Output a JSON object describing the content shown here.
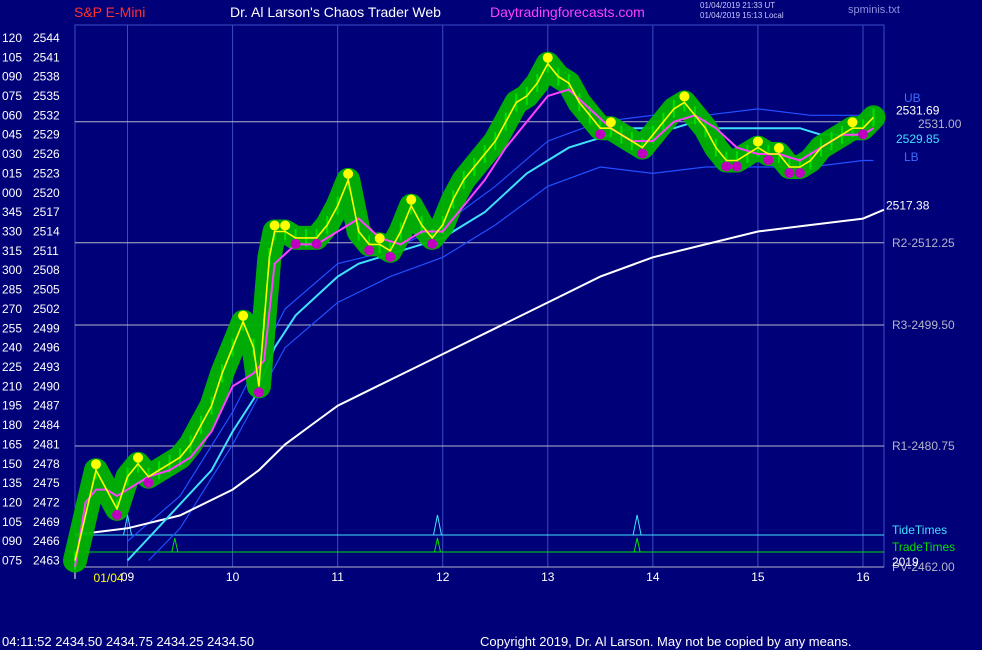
{
  "header": {
    "symbol": "S&P E-Mini",
    "site_title": "Dr. Al Larson's Chaos Trader Web",
    "site_url": "Daytradingforecasts.com",
    "time_utc": "01/04/2019 21:33 UT",
    "time_local": "01/04/2019 15:13 Local",
    "file_name": "spminis.txt"
  },
  "footer": {
    "quote": "04:11:52  2434.50  2434.75  2434.25  2434.50",
    "copyright": "Copyright 2019, Dr. Al Larson. May not be copied by any means."
  },
  "colors": {
    "background": "#000078",
    "price_line": "#ffff00",
    "price_bar": "#00e000",
    "glow": "#00b400",
    "high_dot": "#ffff00",
    "low_dot": "#c000c0",
    "ma_fast": "#ff40ff",
    "ma_cyan": "#40e0ff",
    "ma_white": "#ffffff",
    "band": "#2050ff",
    "grid": "#3c4cc8",
    "level": "#b4b4c8",
    "tide": "#40e0ff",
    "trade": "#00e000",
    "header_symbol": "#ff3030",
    "header_title": "#ffffff",
    "header_url": "#ff40ff",
    "footer_text": "#ffffff",
    "axis_text": "#ffffff",
    "date_text": "#ffff00"
  },
  "chart_data": {
    "type": "line",
    "title": "S&P E-Mini",
    "y_axis": {
      "range": [
        2462,
        2546
      ],
      "left_labels": [
        "120",
        "105",
        "090",
        "075",
        "060",
        "045",
        "030",
        "015",
        "000",
        "345",
        "330",
        "315",
        "300",
        "285",
        "270",
        "255",
        "240",
        "225",
        "210",
        "195",
        "180",
        "165",
        "150",
        "135",
        "120",
        "105",
        "090",
        "075"
      ],
      "right_labels": [
        "2544",
        "2541",
        "2538",
        "2535",
        "2532",
        "2529",
        "2526",
        "2523",
        "2520",
        "2517",
        "2514",
        "2511",
        "2508",
        "2505",
        "2502",
        "2499",
        "2496",
        "2493",
        "2490",
        "2487",
        "2484",
        "2481",
        "2478",
        "2475",
        "2472",
        "2469",
        "2466",
        "2463"
      ]
    },
    "x_axis": {
      "range": [
        8.5,
        16.2
      ],
      "ticks": [
        9,
        10,
        11,
        12,
        13,
        14,
        15,
        16
      ],
      "tick_labels": [
        "09",
        "10",
        "11",
        "12",
        "13",
        "14",
        "15",
        "16"
      ],
      "date_label": "01/04"
    },
    "levels": [
      {
        "label": "R2-2512.25",
        "value": 2512.25
      },
      {
        "label": "R3-2499.50",
        "value": 2499.5
      },
      {
        "label": "R1-2480.75",
        "value": 2480.75
      },
      {
        "label": "PV-2462.00",
        "value": 2462.0
      }
    ],
    "markers": [
      {
        "label": "2531.69",
        "value": 2531.69,
        "color": "#ffffff"
      },
      {
        "label": "2531.00",
        "value": 2531.0,
        "color": "#b4b4c8"
      },
      {
        "label": "2529.85",
        "value": 2529.85,
        "color": "#40e0ff"
      },
      {
        "label": "2517.38",
        "value": 2517.38,
        "color": "#ffffff"
      }
    ],
    "band_labels": {
      "upper": "UB",
      "lower": "LB"
    },
    "series": [
      {
        "name": "price",
        "x": [
          8.5,
          8.7,
          8.9,
          9.0,
          9.1,
          9.2,
          9.3,
          9.4,
          9.5,
          9.6,
          9.7,
          9.8,
          9.9,
          10.0,
          10.1,
          10.2,
          10.25,
          10.3,
          10.35,
          10.4,
          10.5,
          10.6,
          10.7,
          10.8,
          10.9,
          11.0,
          11.1,
          11.2,
          11.3,
          11.4,
          11.5,
          11.6,
          11.7,
          11.8,
          11.9,
          12.0,
          12.1,
          12.2,
          12.3,
          12.4,
          12.5,
          12.6,
          12.7,
          12.8,
          12.9,
          13.0,
          13.1,
          13.2,
          13.3,
          13.4,
          13.5,
          13.6,
          13.7,
          13.8,
          13.9,
          14.0,
          14.1,
          14.2,
          14.3,
          14.4,
          14.5,
          14.6,
          14.7,
          14.8,
          14.9,
          15.0,
          15.1,
          15.2,
          15.3,
          15.4,
          15.5,
          15.6,
          15.7,
          15.8,
          15.9,
          16.0,
          16.1
        ],
        "values": [
          2463,
          2477,
          2471,
          2476,
          2478,
          2476,
          2477,
          2478,
          2479,
          2481,
          2484,
          2487,
          2492,
          2496,
          2500,
          2496,
          2490,
          2500,
          2510,
          2514,
          2514,
          2513,
          2513,
          2513,
          2515,
          2518,
          2522,
          2514,
          2512,
          2512,
          2511,
          2514,
          2518,
          2515,
          2513,
          2515,
          2519,
          2522,
          2524,
          2526,
          2528,
          2531,
          2534,
          2535,
          2537,
          2540,
          2538,
          2537,
          2534,
          2532,
          2530,
          2530,
          2529,
          2528,
          2527,
          2529,
          2531,
          2533,
          2534,
          2532,
          2530,
          2527,
          2525,
          2525,
          2526,
          2527,
          2526,
          2526,
          2524,
          2524,
          2525,
          2527,
          2528,
          2529,
          2530,
          2530,
          2531.69
        ]
      },
      {
        "name": "fast MA",
        "x": [
          8.5,
          8.6,
          8.7,
          8.8,
          8.9,
          9.0,
          9.2,
          9.4,
          9.6,
          9.8,
          10.0,
          10.2,
          10.3,
          10.4,
          10.6,
          10.8,
          11.0,
          11.2,
          11.4,
          11.6,
          11.8,
          12.0,
          12.2,
          12.4,
          12.6,
          12.8,
          13.0,
          13.2,
          13.4,
          13.6,
          13.8,
          14.0,
          14.2,
          14.4,
          14.6,
          14.8,
          15.0,
          15.2,
          15.4,
          15.6,
          15.8,
          16.0,
          16.1
        ],
        "values": [
          2462,
          2472,
          2474,
          2474,
          2473,
          2474,
          2476,
          2477,
          2479,
          2483,
          2490,
          2492,
          2494,
          2509,
          2512,
          2512,
          2514,
          2516,
          2513,
          2512,
          2514,
          2514,
          2518,
          2522,
          2527,
          2531,
          2535,
          2536,
          2533,
          2530,
          2528,
          2528,
          2531,
          2532,
          2530,
          2527,
          2526,
          2526,
          2525,
          2527,
          2529,
          2529,
          2530
        ]
      },
      {
        "name": "cyan MA",
        "x": [
          9.0,
          9.4,
          9.8,
          10.0,
          10.2,
          10.4,
          10.6,
          10.8,
          11.0,
          11.2,
          11.4,
          11.6,
          11.8,
          12.0,
          12.2,
          12.4,
          12.6,
          12.8,
          13.0,
          13.2,
          13.4,
          13.6,
          13.8,
          14.0,
          14.2,
          14.4,
          14.6,
          14.8,
          15.0,
          15.2,
          15.4,
          15.6,
          15.8,
          16.0,
          16.1
        ],
        "values": [
          2463,
          2470,
          2477,
          2483,
          2488,
          2496,
          2501,
          2504,
          2507,
          2509,
          2510,
          2511,
          2512,
          2513,
          2515,
          2517,
          2520,
          2523,
          2525,
          2527,
          2528,
          2529,
          2530,
          2530,
          2530,
          2531,
          2530,
          2530,
          2530,
          2530,
          2530,
          2529,
          2529,
          2529,
          2529.85
        ]
      },
      {
        "name": "white MA",
        "x": [
          8.5,
          9.0,
          9.5,
          10.0,
          10.25,
          10.5,
          10.75,
          11.0,
          11.25,
          11.5,
          11.75,
          12.0,
          12.5,
          13.0,
          13.5,
          14.0,
          14.5,
          15.0,
          15.5,
          16.0,
          16.2
        ],
        "values": [
          2467,
          2468,
          2470,
          2474,
          2477,
          2481,
          2484,
          2487,
          2489,
          2491,
          2493,
          2495,
          2499,
          2503,
          2507,
          2510,
          2512,
          2514,
          2515,
          2516,
          2517.38
        ]
      },
      {
        "name": "upper band",
        "x": [
          9.0,
          9.5,
          10.0,
          10.5,
          11.0,
          11.5,
          12.0,
          12.5,
          13.0,
          13.5,
          14.0,
          14.5,
          15.0,
          15.5,
          16.0,
          16.1
        ],
        "values": [
          2466,
          2473,
          2486,
          2502,
          2509,
          2511,
          2515,
          2521,
          2528,
          2531,
          2532,
          2532,
          2533,
          2532,
          2532,
          2532
        ]
      },
      {
        "name": "lower band",
        "x": [
          9.2,
          9.5,
          10.0,
          10.5,
          11.0,
          11.5,
          12.0,
          12.5,
          13.0,
          13.5,
          14.0,
          14.5,
          15.0,
          15.5,
          16.0,
          16.1
        ],
        "values": [
          2463,
          2468,
          2481,
          2496,
          2503,
          2507,
          2510,
          2515,
          2521,
          2524,
          2523,
          2524,
          2524,
          2524,
          2525,
          2525
        ]
      }
    ],
    "tide_times": [
      9.0,
      11.95,
      13.85
    ],
    "trade_times": [
      9.45,
      11.95,
      13.85
    ],
    "timing_labels": {
      "tide": "TideTimes",
      "trade": "TradeTimes",
      "year": "2019"
    }
  }
}
